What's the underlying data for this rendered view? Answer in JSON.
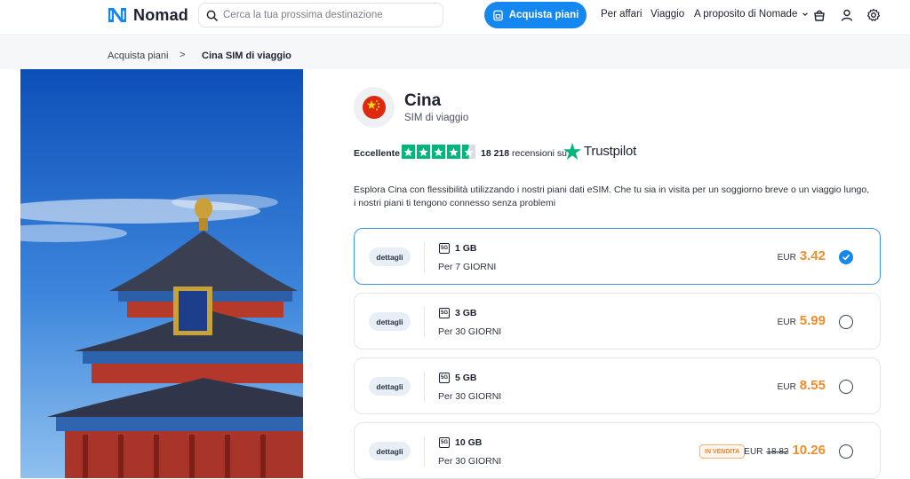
{
  "header": {
    "brand": "Nomad",
    "search_placeholder": "Cerca la tua prossima destinazione",
    "buy_button": "Acquista piani",
    "nav_business": "Per affari",
    "nav_travel": "Viaggio",
    "nav_about": "A proposito di Nomade"
  },
  "breadcrumb": {
    "item1": "Acquista piani",
    "separator": ">",
    "item2": "Cina SIM di viaggio"
  },
  "country": {
    "name": "Cina",
    "subtitle": "SIM di viaggio"
  },
  "rating": {
    "label": "Eccellente",
    "stars": 4.5,
    "review_count": "18 218",
    "review_suffix": "recensioni su",
    "provider": "Trustpilot"
  },
  "description": "Esplora Cina con flessibilità utilizzando i nostri piani dati eSIM. Che tu sia in visita per un soggiorno breve o un viaggio lungo, i nostri piani ti tengono connesso senza problemi",
  "plans": [
    {
      "details": "dettagli",
      "network": "5G",
      "data": "1 GB",
      "duration": "Per 7 GIORNI",
      "currency": "EUR",
      "price": "3.42",
      "selected": true
    },
    {
      "details": "dettagli",
      "network": "5G",
      "data": "3 GB",
      "duration": "Per 30 GIORNI",
      "currency": "EUR",
      "price": "5.99",
      "selected": false
    },
    {
      "details": "dettagli",
      "network": "5G",
      "data": "5 GB",
      "duration": "Per 30 GIORNI",
      "currency": "EUR",
      "price": "8.55",
      "selected": false
    },
    {
      "details": "dettagli",
      "network": "5G",
      "data": "10 GB",
      "duration": "Per 30 GIORNI",
      "currency": "EUR",
      "old_price": "18.82",
      "price": "10.26",
      "sale_badge": "IN VENDITA",
      "selected": false
    }
  ],
  "colors": {
    "accent": "#1587f0",
    "price": "#f08c2a",
    "trustpilot": "#00b67a"
  }
}
